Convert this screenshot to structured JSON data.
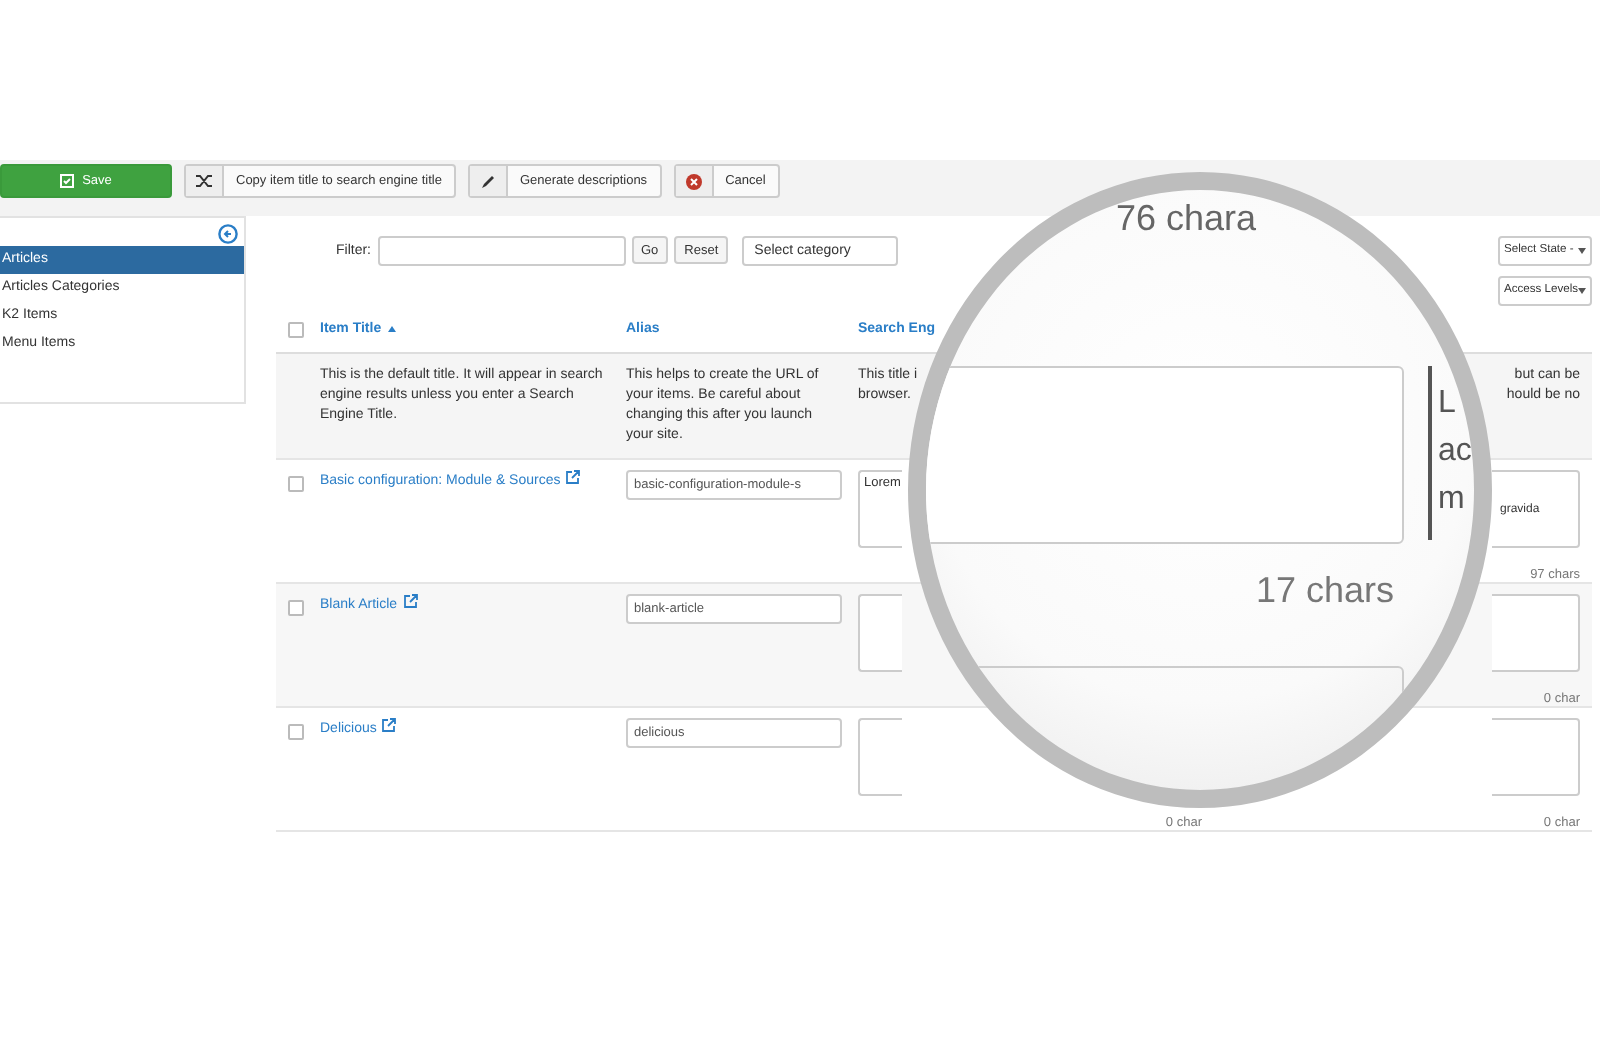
{
  "toolbar": [
    {
      "kind": "save",
      "label": "Save"
    },
    {
      "kind": "shuffle",
      "label": "Copy item title to search engine title"
    },
    {
      "kind": "pencil",
      "label": "Generate descriptions"
    },
    {
      "kind": "cancel",
      "label": "Cancel"
    }
  ],
  "sidebar": {
    "items": [
      {
        "label": "Articles",
        "selected": true
      },
      {
        "label": "Articles Categories",
        "selected": false
      },
      {
        "label": "K2 Items",
        "selected": false
      },
      {
        "label": "Menu Items",
        "selected": false
      }
    ]
  },
  "filters": {
    "label": "Filter:",
    "go": "Go",
    "reset": "Reset",
    "category": "Select category",
    "state": "Select State -",
    "access": "Access Levels"
  },
  "table": {
    "select_all_checked": false,
    "columns": [
      {
        "label": "Item Title",
        "sorted": true
      },
      {
        "label": "Alias",
        "sorted": false
      },
      {
        "label": "Search Eng",
        "sorted": false
      }
    ],
    "help": {
      "title": "This is the default title. It will appear in search engine results unless you enter a Search Engine Title.",
      "alias": "This helps to create the URL of your items. Be careful about changing this after you launch your site.",
      "seo": [
        "This title i",
        "browser."
      ],
      "desc": [
        "but can be",
        "hould be no"
      ]
    },
    "rows": [
      {
        "checked": false,
        "title": "Basic configuration: Module & Sources",
        "alias": "basic-configuration-module-s",
        "seo_title": "Lorem",
        "desc": "gravida",
        "desc_count": "97 chars"
      },
      {
        "checked": false,
        "title": "Blank Article",
        "alias": "blank-article",
        "desc_count": "0 char"
      },
      {
        "checked": false,
        "title": "Delicious",
        "alias": "delicious",
        "seo_count": "0 char",
        "desc_count": "0 char"
      }
    ]
  },
  "magnifier": {
    "top_text": "76 chara",
    "letters": [
      "L",
      "ac",
      "m"
    ],
    "count": "17 chars"
  }
}
